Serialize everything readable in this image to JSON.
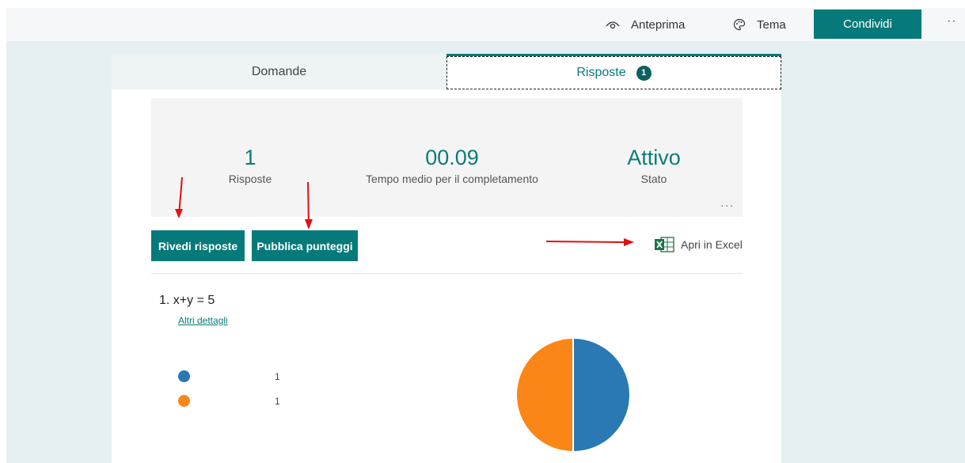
{
  "topbar": {
    "preview_label": "Anteprima",
    "theme_label": "Tema",
    "share_label": "Condividi",
    "more_label": "··"
  },
  "tabs": {
    "questions_label": "Domande",
    "responses_label": "Risposte",
    "responses_badge": "1"
  },
  "summary": {
    "responses_value": "1",
    "responses_label": "Risposte",
    "avg_time_value": "00.09",
    "avg_time_label": "Tempo medio per il completamento",
    "status_value": "Attivo",
    "status_label": "Stato",
    "more_label": "..."
  },
  "actions": {
    "review_label": "Rivedi risposte",
    "publish_label": "Pubblica punteggi",
    "excel_label": "Apri in Excel"
  },
  "question": {
    "number": "1.",
    "text": "x+y = 5",
    "details_link": "Altri dettagli",
    "options": [
      {
        "count": "1",
        "color": "#2a78b4"
      },
      {
        "count": "1",
        "color": "#fb8618"
      }
    ]
  },
  "chart_data": {
    "type": "pie",
    "values": [
      1,
      1
    ],
    "colors": [
      "#2a78b4",
      "#fb8618"
    ]
  },
  "colors": {
    "accent": "#067a7a",
    "annotation_arrow": "#e01010"
  }
}
